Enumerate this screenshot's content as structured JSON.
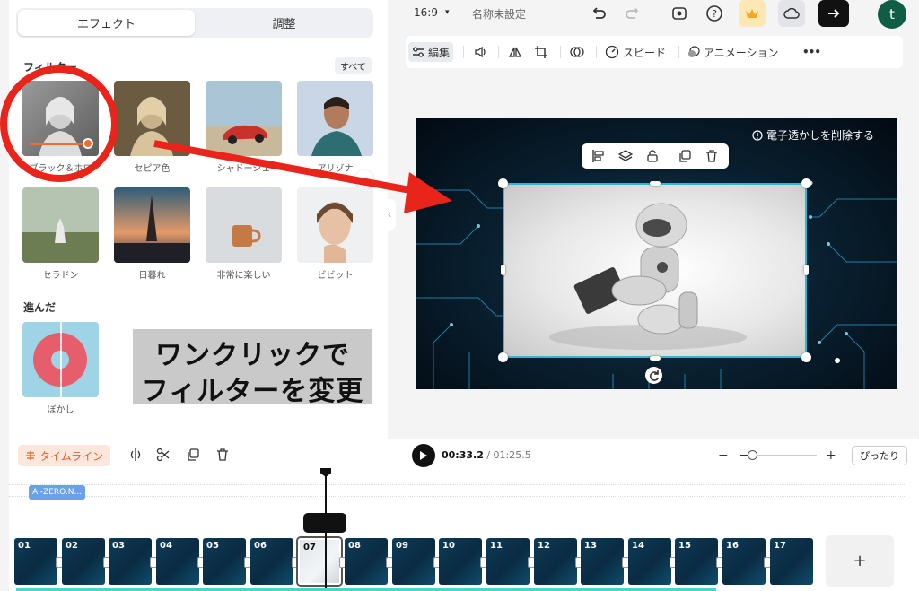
{
  "left_panel": {
    "tabs": [
      {
        "label": "エフェクト",
        "active": true
      },
      {
        "label": "調整",
        "active": false
      }
    ],
    "filters_section": {
      "title": "フィルター",
      "all_label": "すべて",
      "items": [
        {
          "label": "ブラック＆ホワ",
          "selected": true
        },
        {
          "label": "セピア色"
        },
        {
          "label": "シャドーシェ"
        },
        {
          "label": "アリゾナ"
        },
        {
          "label": "セラドン"
        },
        {
          "label": "日暮れ"
        },
        {
          "label": "非常に楽しい"
        },
        {
          "label": "ビビット"
        }
      ]
    },
    "advanced_section": {
      "title": "進んだ",
      "items": [
        {
          "label": "ぼかし"
        }
      ]
    },
    "caption": {
      "line1": "ワンクリックで",
      "line2": "フィルターを変更"
    }
  },
  "topbar": {
    "aspect_ratio": "16:9",
    "project_name": "名称未設定"
  },
  "toolbar": {
    "edit_label": "編集",
    "speed_label": "スピード",
    "animation_label": "アニメーション",
    "more_label": "•••"
  },
  "canvas": {
    "watermark_label": "電子透かしを削除する"
  },
  "timeline": {
    "timeline_label": "タイムライン",
    "current_time": "00:33.2",
    "total_time": "/ 01:25.5",
    "fit_label": "ぴったり",
    "audio_clip_label": "AI-ZERO.N...",
    "clips": [
      "01",
      "02",
      "03",
      "04",
      "05",
      "06",
      "07",
      "08",
      "09",
      "10",
      "11",
      "12",
      "13",
      "14",
      "15",
      "16",
      "17"
    ],
    "selected_clip": "07",
    "add_label": "+"
  },
  "colors": {
    "accent_orange": "#f36c2b",
    "annotation_red": "#e8241b",
    "selection_cyan": "#2fb7d4",
    "progress_teal": "#4ed3c8"
  }
}
